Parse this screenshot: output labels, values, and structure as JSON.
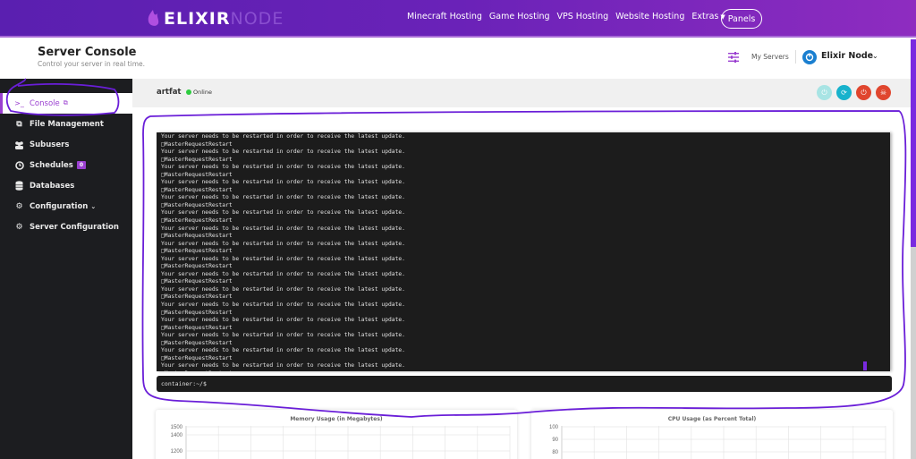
{
  "topnav": {
    "logo_primary": "ELIXIR",
    "logo_secondary": "NODE",
    "links": [
      "Minecraft Hosting",
      "Game Hosting",
      "VPS Hosting",
      "Website Hosting",
      "Extras"
    ],
    "panels_label": "Panels"
  },
  "header": {
    "title": "Server Console",
    "subtitle": "Control your server in real time.",
    "my_servers_label": "My Servers",
    "account_name": "Elixir Node"
  },
  "sidebar": {
    "items": [
      {
        "label": "Console",
        "icon": "terminal-icon",
        "active": true
      },
      {
        "label": "File Management",
        "icon": "files-icon"
      },
      {
        "label": "Subusers",
        "icon": "users-icon"
      },
      {
        "label": "Schedules",
        "icon": "clock-icon",
        "badge": "0"
      },
      {
        "label": "Databases",
        "icon": "database-icon"
      },
      {
        "label": "Configuration",
        "icon": "cogs-icon"
      },
      {
        "label": "Server Configuration",
        "icon": "gear-icon"
      }
    ]
  },
  "server": {
    "name": "artfat",
    "status": "Online",
    "status_color": "#2ecc40",
    "controls": [
      {
        "name": "start",
        "icon": "power-icon",
        "color": "#a8e4e4"
      },
      {
        "name": "restart",
        "icon": "refresh-icon",
        "color": "#17b2cc"
      },
      {
        "name": "stop",
        "icon": "power-icon",
        "color": "#e0462e"
      },
      {
        "name": "kill",
        "icon": "skull-icon",
        "color": "#e0462e"
      }
    ]
  },
  "console": {
    "line_a": "Your server needs to be restarted in order to receive the latest update.",
    "line_b": "□MasterRequestRestart",
    "repeat_count": 16,
    "prompt": "container:~/$"
  },
  "charts": {
    "memory": {
      "title": "Memory Usage (in Megabytes)",
      "ticks": [
        "1500",
        "1400",
        "1200"
      ]
    },
    "cpu": {
      "title": "CPU Usage (as Percent Total)",
      "ticks": [
        "100",
        "90",
        "80"
      ]
    }
  },
  "chart_data": [
    {
      "type": "line",
      "title": "Memory Usage (in Megabytes)",
      "xlabel": "",
      "ylabel": "",
      "y_ticks": [
        1500,
        1400,
        1200
      ],
      "ylim": [
        null,
        1500
      ],
      "grid": true,
      "series": []
    },
    {
      "type": "line",
      "title": "CPU Usage (as Percent Total)",
      "xlabel": "",
      "ylabel": "",
      "y_ticks": [
        100,
        90,
        80
      ],
      "ylim": [
        null,
        100
      ],
      "grid": true,
      "series": []
    }
  ],
  "accent_color": "#9a3fd0"
}
